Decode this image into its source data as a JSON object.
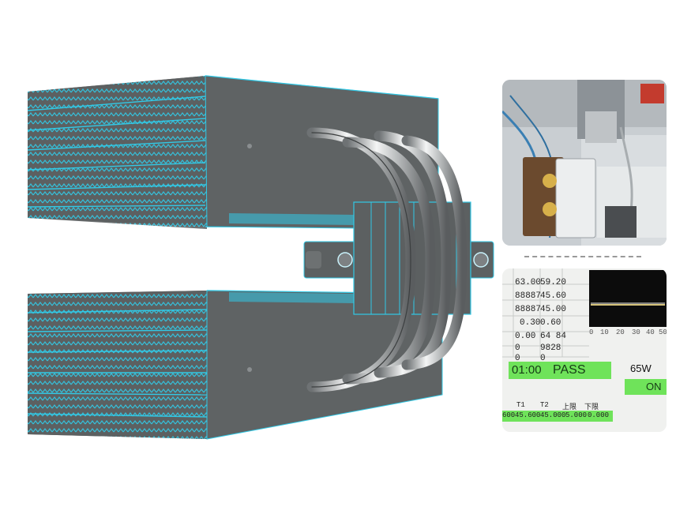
{
  "photo_screen": {
    "table_rows": [
      [
        "63.00",
        "59.20"
      ],
      [
        "88887",
        "45.60"
      ],
      [
        "88887",
        "45.00"
      ],
      [
        "0.30",
        "0.60"
      ],
      [
        "0.00",
        "64 84"
      ],
      [
        "0",
        "9828"
      ],
      [
        "0",
        "0"
      ]
    ],
    "axis_ticks": [
      "0",
      "10",
      "20",
      "30",
      "40",
      "50"
    ],
    "timer": "01:00",
    "status": "PASS",
    "power": "65W",
    "switch": "ON",
    "col_headers": [
      "T1",
      "T2",
      "上限",
      "下限"
    ],
    "bottom_values": [
      "600",
      "45.600",
      "45.000",
      "5.000",
      "0.000"
    ]
  },
  "colors": {
    "accent": "#31c9e6",
    "body": "#5c6061",
    "pass_green": "#6fe35a"
  }
}
